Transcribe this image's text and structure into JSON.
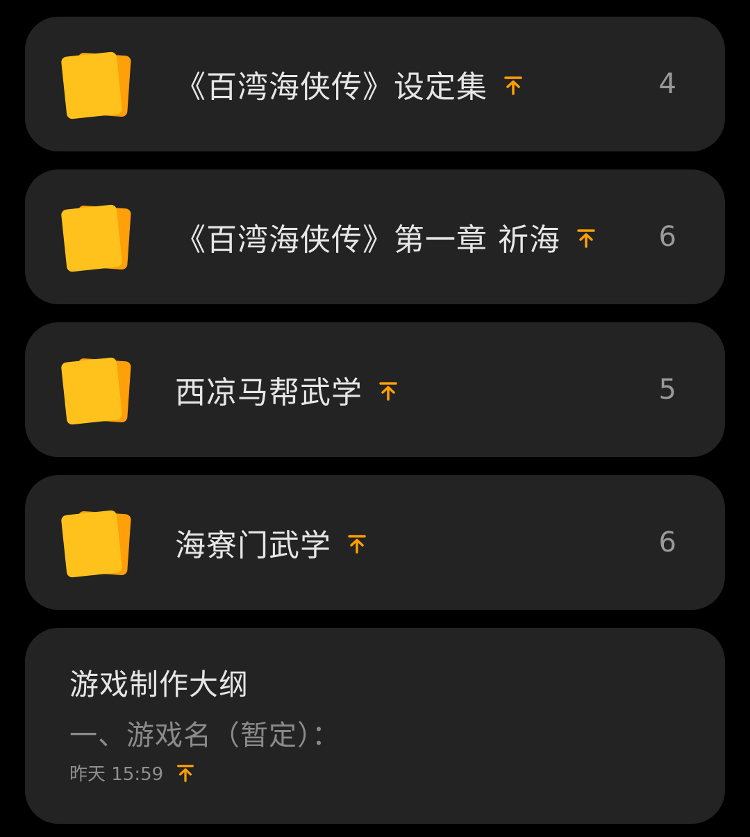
{
  "accent_color": "#FFA000",
  "folders": [
    {
      "title": "《百湾海侠传》设定集",
      "count": "4",
      "icon": "folder-stack-icon",
      "pinned_icon": "pin-top-icon"
    },
    {
      "title": "《百湾海侠传》第一章 祈海",
      "count": "6",
      "icon": "folder-stack-icon",
      "pinned_icon": "pin-top-icon"
    },
    {
      "title": "西凉马帮武学",
      "count": "5",
      "icon": "folder-stack-icon",
      "pinned_icon": "pin-top-icon"
    },
    {
      "title": "海寮门武学",
      "count": "6",
      "icon": "folder-stack-icon",
      "pinned_icon": "pin-top-icon"
    }
  ],
  "note": {
    "title": "游戏制作大纲",
    "snippet": "一、游戏名（暂定）：",
    "time": "昨天 15:59",
    "pinned_icon": "pin-top-icon"
  }
}
